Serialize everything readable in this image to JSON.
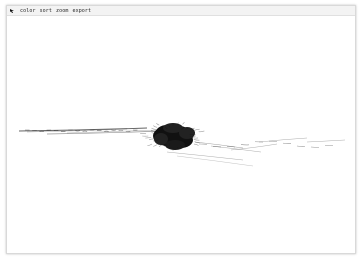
{
  "menubar": {
    "items": [
      {
        "label": "color"
      },
      {
        "label": "sort"
      },
      {
        "label": "zoom"
      },
      {
        "label": "export"
      }
    ]
  },
  "visualization": {
    "ink_color": "#111111",
    "background_color": "#ffffff"
  }
}
